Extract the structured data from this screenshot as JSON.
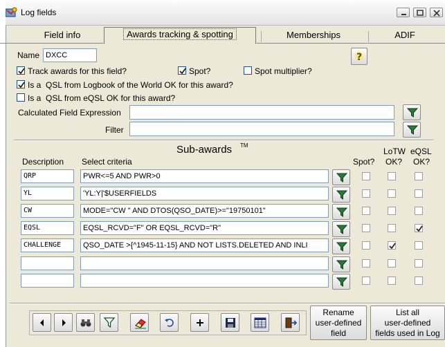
{
  "window": {
    "title": "Log fields"
  },
  "tabs": [
    {
      "label": "Field info"
    },
    {
      "label": "Awards tracking & spotting"
    },
    {
      "label": "Memberships"
    },
    {
      "label": "ADIF"
    }
  ],
  "form": {
    "name_label": "Name",
    "name_value": "DXCC",
    "help_icon": "question-icon",
    "track_awards": {
      "label": "Track awards for this field?",
      "checked": true
    },
    "spot": {
      "label": "Spot?",
      "checked": true
    },
    "spot_multiplier": {
      "label": "Spot multiplier?",
      "checked": false
    },
    "lotw_ok": {
      "label": "Is a  QSL from Logbook of the World OK for this award?",
      "checked": true
    },
    "eqsl_ok": {
      "label": "Is a  QSL from eQSL OK for this award?",
      "checked": false
    },
    "calc_expr_label": "Calculated Field Expression",
    "calc_expr_value": "",
    "filter_label": "Filter",
    "filter_value": ""
  },
  "subawards": {
    "title": "Sub-awards",
    "tm": "TM",
    "col_description": "Description",
    "col_criteria": "Select criteria",
    "col_spot": "Spot?",
    "col_lotw_1": "LoTW",
    "col_lotw_2": "OK?",
    "col_eqsl_1": "eQSL",
    "col_eqsl_2": "OK?",
    "rows": [
      {
        "description": "QRP",
        "criteria": "PWR<=5 AND PWR>0",
        "spot": false,
        "lotw": false,
        "eqsl": false
      },
      {
        "description": "YL",
        "criteria": "'YL:Y|'$USERFIELDS",
        "spot": false,
        "lotw": false,
        "eqsl": false
      },
      {
        "description": "CW",
        "criteria": "MODE=\"CW \" AND DTOS(QSO_DATE)>=\"19750101\"",
        "spot": false,
        "lotw": false,
        "eqsl": false
      },
      {
        "description": "EQSL",
        "criteria": "EQSL_RCVD=\"F\" OR EQSL_RCVD=\"R\"",
        "spot": false,
        "lotw": false,
        "eqsl": true
      },
      {
        "description": "CHALLENGE",
        "criteria": "QSO_DATE >{^1945-11-15} AND NOT LISTS.DELETED AND INLI",
        "spot": false,
        "lotw": true,
        "eqsl": false
      },
      {
        "description": "",
        "criteria": "",
        "spot": false,
        "lotw": false,
        "eqsl": false
      },
      {
        "description": "",
        "criteria": "",
        "spot": false,
        "lotw": false,
        "eqsl": false
      }
    ]
  },
  "toolbar": {
    "buttons": [
      "prev-icon",
      "next-icon",
      "binoculars-icon",
      "filter-icon",
      "eraser-icon",
      "undo-icon",
      "add-icon",
      "save-icon",
      "table-icon",
      "exit-icon"
    ]
  },
  "rename_button": {
    "line1": "Rename",
    "line2": "user-defined",
    "line3": "field"
  },
  "list_button": {
    "line1": "List all",
    "line2": "user-defined",
    "line3": "fields used in Log"
  },
  "colors": {
    "client_bg": "#ece9d8",
    "input_border": "#7f9db9",
    "check_color": "#21a121"
  }
}
